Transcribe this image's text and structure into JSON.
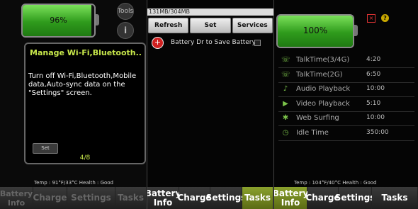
{
  "colors": {
    "accent": "#c8e84b",
    "battery_green": "#5fc93a",
    "active_tab": "#7a8f22"
  },
  "left_panel": {
    "battery_percent": 96,
    "battery_label": "96%",
    "tools_label": "Tools",
    "info_icon": "info-icon",
    "dialog": {
      "title": "Manage Wi-Fi,Bluetooth...",
      "body": "Turn off Wi-Fi,Bluetooth,Mobile data,Auto-sync data on the \"Settings\" screen.",
      "set_label": "Set",
      "pager": "4/8"
    },
    "footer": "Temp : 91°F/33°C     Health : Good",
    "tabs": [
      "Battery Info",
      "Charge",
      "Settings",
      "Tasks"
    ]
  },
  "middle_panel": {
    "storage": "131MB/304MB",
    "toolbar": [
      "Refresh",
      "Set",
      "Services"
    ],
    "item": {
      "icon": "plus-icon",
      "label": "Battery Dr to Save Battery"
    },
    "tabs": [
      "Battery Info",
      "Charge",
      "Settings",
      "Tasks"
    ]
  },
  "right_panel": {
    "battery_percent": 100,
    "battery_label": "100%",
    "stats": [
      {
        "icon": "talk-icon",
        "name": "TalkTime(3/4G)",
        "value": "4:20"
      },
      {
        "icon": "talk-icon",
        "name": "TalkTime(2G)",
        "value": "6:50"
      },
      {
        "icon": "music-icon",
        "name": "Audio Playback",
        "value": "10:00"
      },
      {
        "icon": "video-icon",
        "name": "Video Playback",
        "value": "5:10"
      },
      {
        "icon": "globe-icon",
        "name": "Web Surfing",
        "value": "10:00"
      },
      {
        "icon": "clock-icon",
        "name": "Idle Time",
        "value": "350:00"
      }
    ],
    "footer": "Temp : 104°F/40°C     Health : Good",
    "tabs": [
      "Battery Info",
      "Charge",
      "Settings",
      "Tasks"
    ]
  }
}
